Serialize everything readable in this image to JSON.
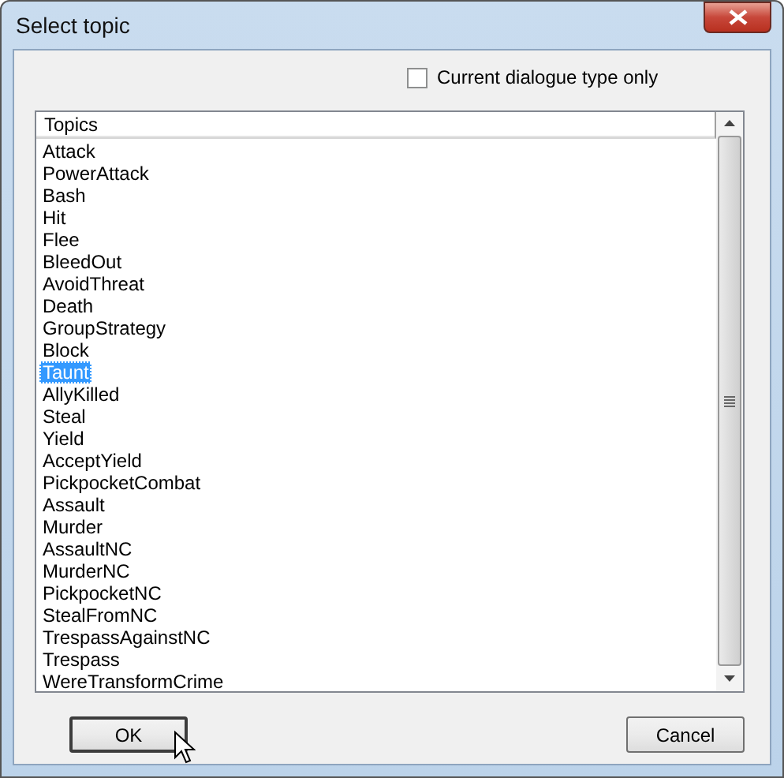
{
  "window": {
    "title": "Select topic"
  },
  "filter": {
    "label": "Current dialogue type only",
    "checked": false
  },
  "list": {
    "header": "Topics",
    "items": [
      {
        "label": "Attack",
        "selected": false
      },
      {
        "label": "PowerAttack",
        "selected": false
      },
      {
        "label": "Bash",
        "selected": false
      },
      {
        "label": "Hit",
        "selected": false
      },
      {
        "label": "Flee",
        "selected": false
      },
      {
        "label": "BleedOut",
        "selected": false
      },
      {
        "label": "AvoidThreat",
        "selected": false
      },
      {
        "label": "Death",
        "selected": false
      },
      {
        "label": "GroupStrategy",
        "selected": false
      },
      {
        "label": "Block",
        "selected": false
      },
      {
        "label": "Taunt",
        "selected": true
      },
      {
        "label": "AllyKilled",
        "selected": false
      },
      {
        "label": "Steal",
        "selected": false
      },
      {
        "label": "Yield",
        "selected": false
      },
      {
        "label": "AcceptYield",
        "selected": false
      },
      {
        "label": "PickpocketCombat",
        "selected": false
      },
      {
        "label": "Assault",
        "selected": false
      },
      {
        "label": "Murder",
        "selected": false
      },
      {
        "label": "AssaultNC",
        "selected": false
      },
      {
        "label": "MurderNC",
        "selected": false
      },
      {
        "label": "PickpocketNC",
        "selected": false
      },
      {
        "label": "StealFromNC",
        "selected": false
      },
      {
        "label": "TrespassAgainstNC",
        "selected": false
      },
      {
        "label": "Trespass",
        "selected": false
      },
      {
        "label": "WereTransformCrime",
        "selected": false
      }
    ]
  },
  "buttons": [
    {
      "label": "OK",
      "default": true
    },
    {
      "label": "Cancel",
      "default": false
    }
  ]
}
